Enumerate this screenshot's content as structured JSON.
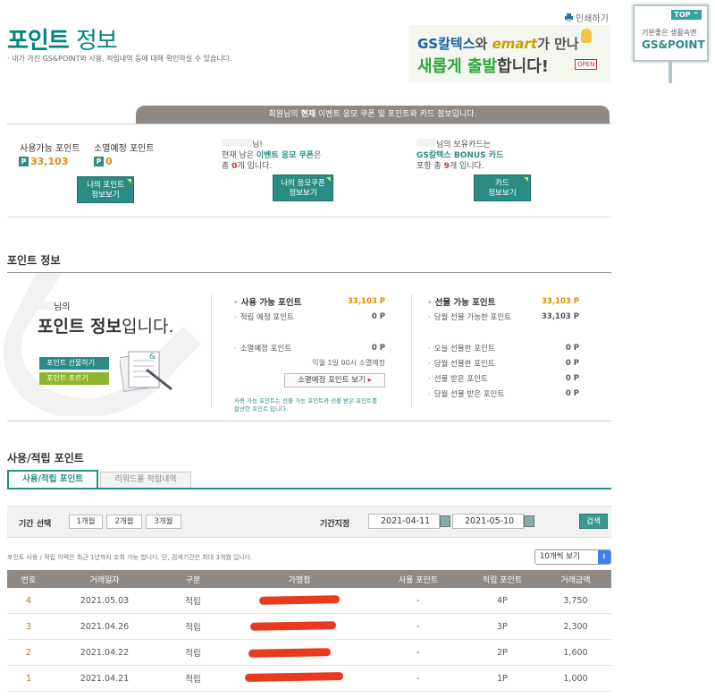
{
  "header": {
    "title_bold": "포인트",
    "title_light": "정보",
    "subtitle": "· 내가 가진 GS&POINT와 사용, 적립내역 등에 대해 확인하실 수 있습니다.",
    "print_label": "인쇄하기",
    "banner": {
      "brand1": "GS칼텍스",
      "connector1": "와",
      "brand2": "emart",
      "connector2": "가 만나",
      "headline_green": "새롭게 출발",
      "headline_rest": "합니다!",
      "open_sign": "OPEN"
    },
    "sign": {
      "top_label": "TOP",
      "line1": "기분좋은 생활속엔",
      "line2": "GS&POINT"
    }
  },
  "strip": {
    "pre": "회원님의",
    "bold": "현재",
    "post": "이벤트 응모 쿠폰 및 포인트와 카드 정보입니다."
  },
  "summary": {
    "available_label": "사용가능 포인트",
    "available_value": "33,103",
    "expiring_label": "소멸예정 포인트",
    "expiring_value": "0",
    "point_badge": "P",
    "my_points_btn": [
      "나의 포인트",
      "정보보기"
    ],
    "coupon_greeting": "님!",
    "coupon_line1_pre": "현재 남은",
    "coupon_line1_bold": "이벤트 응모 쿠폰",
    "coupon_line1_post": "은",
    "coupon_line2_pre": "총",
    "coupon_count": "0",
    "coupon_line2_post": "개 입니다.",
    "coupon_btn": [
      "나의 응모쿠폰",
      "정보보기"
    ],
    "card_greeting": "님의 보유카드는",
    "card_name": "GS칼텍스 BONUS 카드",
    "card_line2_pre": "포함 총",
    "card_count": "9",
    "card_line2_post": "개 입니다.",
    "card_btn": [
      "카드",
      "정보보기"
    ]
  },
  "point_info": {
    "section_title": "포인트 정보",
    "welcome_suffix": "님의",
    "welcome_big_bold": "포인트 정보",
    "welcome_big_rest": "입니다.",
    "gift_btn": "포인트 선물하기",
    "lookup_btn": "포인트 조르기",
    "left_rows": [
      {
        "label": "사용 가능 포인트",
        "value": "33,103 P"
      },
      {
        "label": "적립 예정 포인트",
        "value": "0 P"
      }
    ],
    "expire_row": {
      "label": "소멸예정 포인트",
      "value": "0 P"
    },
    "expire_date": "익월 1일 00시 소멸예정",
    "expire_btn": "소멸예정 포인트 보기",
    "note_line1": "사용 가능 포인트는 선물 가능 포인트와 선물 받은 포인트를",
    "note_line2": "합산한 포인트 입니다.",
    "right_rows_top": [
      {
        "label": "선물 가능 포인트",
        "value": "33,103 P"
      },
      {
        "label": "당월 선물 가능한 포인트",
        "value": "33,103 P"
      }
    ],
    "right_rows_bottom": [
      {
        "label": "오늘 선물한 포인트",
        "value": "0 P"
      },
      {
        "label": "당월 선물한 포인트",
        "value": "0 P"
      },
      {
        "label": "선물 받은 포인트",
        "value": "0 P"
      },
      {
        "label": "당월 선물 받은 포인트",
        "value": "0 P"
      }
    ]
  },
  "history": {
    "section_title": "사용/적립 포인트",
    "tabs": [
      "사용/적립 포인트",
      "리워드몰 적립내역"
    ],
    "period_label": "기간 선택",
    "period_buttons": [
      "1개월",
      "2개월",
      "3개월"
    ],
    "range_label": "기간지정",
    "date_from": "2021-04-11",
    "date_to": "2021-05-10",
    "search_btn": "검색",
    "table_note": "포인트 사용 / 적립 이력은 최근 1년까지 조회 가능 합니다. 단, 검색기간은 최대 3개월 입니다.",
    "page_size": "10개씩 보기",
    "columns": [
      "번호",
      "거래일자",
      "구분",
      "가맹점",
      "사용 포인트",
      "적립 포인트",
      "거래금액"
    ],
    "rows": [
      {
        "no": "4",
        "date": "2021.05.03",
        "type": "적립",
        "store": "",
        "used": "-",
        "earned": "4P",
        "amount": "3,750"
      },
      {
        "no": "3",
        "date": "2021.04.26",
        "type": "적립",
        "store": "",
        "used": "-",
        "earned": "3P",
        "amount": "2,300"
      },
      {
        "no": "2",
        "date": "2021.04.22",
        "type": "적립",
        "store": "",
        "used": "-",
        "earned": "2P",
        "amount": "1,600"
      },
      {
        "no": "1",
        "date": "2021.04.21",
        "type": "적립",
        "store": "",
        "used": "-",
        "earned": "1P",
        "amount": "1,000"
      }
    ]
  },
  "colors": {
    "brand_teal": "#2a8c85",
    "accent_orange": "#e08a00",
    "header_gray": "#8f8883",
    "redaction_red": "#e83a1e"
  }
}
